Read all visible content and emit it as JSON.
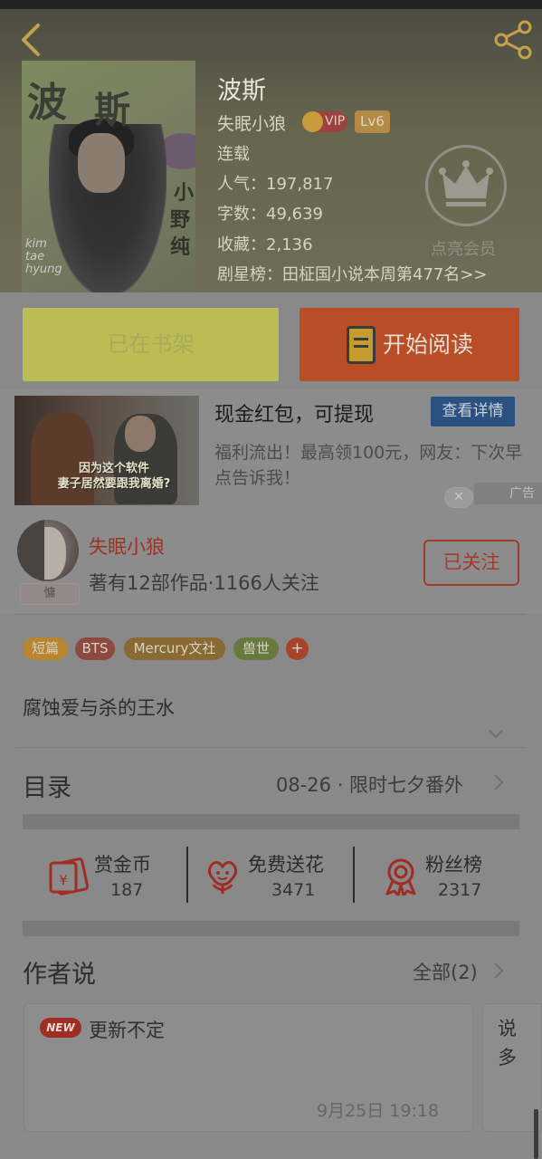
{
  "book": {
    "title": "波斯",
    "author": "失眠小狼",
    "vip_label": "VIP",
    "level": "Lv6",
    "status": "连载",
    "popularity": "人气：197,817",
    "word_count": "字数：49,639",
    "favorites": "收藏：2,136",
    "ranking": "剧星榜：田柾国小说本周第477名>>",
    "cover": {
      "title_chars": [
        "波",
        "斯"
      ],
      "side_chars": [
        "小",
        "野",
        "纯"
      ],
      "subtitle": "kim\ntae\nhyung"
    }
  },
  "member": {
    "label": "点亮会员"
  },
  "actions": {
    "shelf_label": "已在书架",
    "read_label": "开始阅读"
  },
  "ad": {
    "title": "现金红包，可提现",
    "detail_button": "查看详情",
    "description": "福利流出！最高领100元，网友：下次早点告诉我！",
    "caption": "因为这个软件\n妻子居然要跟我离婚?",
    "close": "✕",
    "mark": "广告"
  },
  "author_card": {
    "name": "失眠小狼",
    "stats": "著有12部作品·1166人关注",
    "avatar_tag": "慵",
    "follow_label": "已关注"
  },
  "tags": [
    {
      "label": "短篇",
      "color": "#b8862e"
    },
    {
      "label": "BTS",
      "color": "#8d4a40"
    },
    {
      "label": "Mercury文社",
      "color": "#8a6a34"
    },
    {
      "label": "兽世",
      "color": "#667a3d"
    }
  ],
  "tag_add": "+",
  "summary": "腐蚀爱与杀的王水",
  "toc": {
    "label": "目录",
    "latest": "08-26 · 限时七夕番外"
  },
  "stats": [
    {
      "label": "赏金币",
      "value": "187",
      "icon": "red-envelope-icon"
    },
    {
      "label": "免费送花",
      "value": "3471",
      "icon": "flower-icon"
    },
    {
      "label": "粉丝榜",
      "value": "2317",
      "icon": "award-ribbon-icon"
    }
  ],
  "author_says": {
    "title": "作者说",
    "all_label": "全部(2)",
    "new_badge": "NEW",
    "items": [
      {
        "text": "更新不定",
        "time": "9月25日  19:18"
      },
      {
        "text": "说多"
      }
    ]
  },
  "colors": {
    "accent": "#b84d26",
    "follow": "#a33a2a",
    "shelf": "#bcbc54"
  }
}
